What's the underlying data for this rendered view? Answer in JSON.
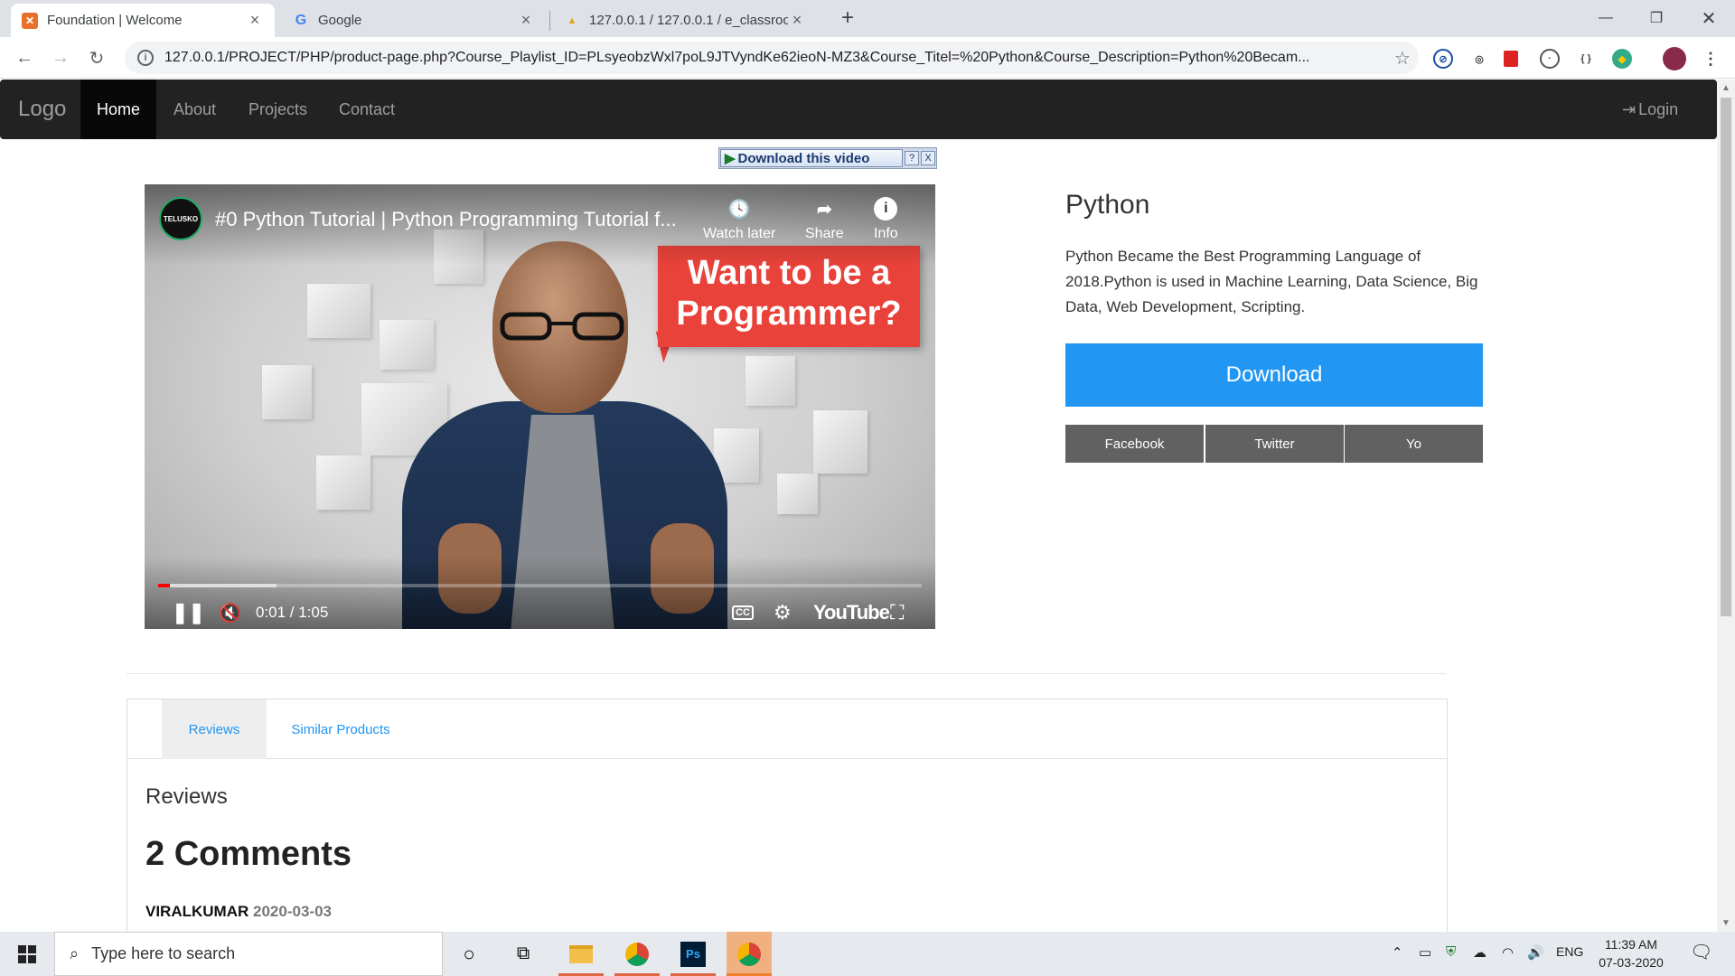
{
  "browser": {
    "tabs": [
      {
        "title": "Foundation | Welcome",
        "active": true
      },
      {
        "title": "Google",
        "active": false
      },
      {
        "title": "127.0.0.1 / 127.0.0.1 / e_classroo",
        "active": false
      }
    ],
    "url": "127.0.0.1/PROJECT/PHP/product-page.php?Course_Playlist_ID=PLsyeobzWxl7poL9JTVyndKe62ieoN-MZ3&Course_Titel=%20Python&Course_Description=Python%20Becam..."
  },
  "navbar": {
    "brand": "Logo",
    "items": [
      "Home",
      "About",
      "Projects",
      "Contact"
    ],
    "login": "Login"
  },
  "download_helper": {
    "label": "Download this video",
    "help": "?",
    "close": "X"
  },
  "video": {
    "channel": "TELUSKO",
    "title": "#0 Python Tutorial | Python Programming Tutorial f...",
    "actions": [
      "Watch later",
      "Share",
      "Info"
    ],
    "thumbnail_text": "Want to be a Programmer?",
    "time": "0:01 / 1:05",
    "played_fraction": 0.015,
    "buffered_fraction": 0.155,
    "brand": "YouTube"
  },
  "product": {
    "title": "Python",
    "description": "Python Became the Best Programming Language of 2018.Python is used in Machine Learning, Data Science, Big Data, Web Development, Scripting.",
    "download_label": "Download",
    "share": [
      "Facebook",
      "Twitter",
      "Yo"
    ],
    "colors": {
      "download": "#2196f3",
      "share": "#616161"
    }
  },
  "panel": {
    "tabs": [
      "Reviews",
      "Similar Products"
    ],
    "heading": "Reviews",
    "comments_heading": "2 Comments",
    "comment": {
      "author": "VIRALKUMAR",
      "date": "2020-03-03"
    }
  },
  "taskbar": {
    "search_placeholder": "Type here to search",
    "lang": "ENG",
    "time": "11:39 AM",
    "date": "07-03-2020"
  }
}
